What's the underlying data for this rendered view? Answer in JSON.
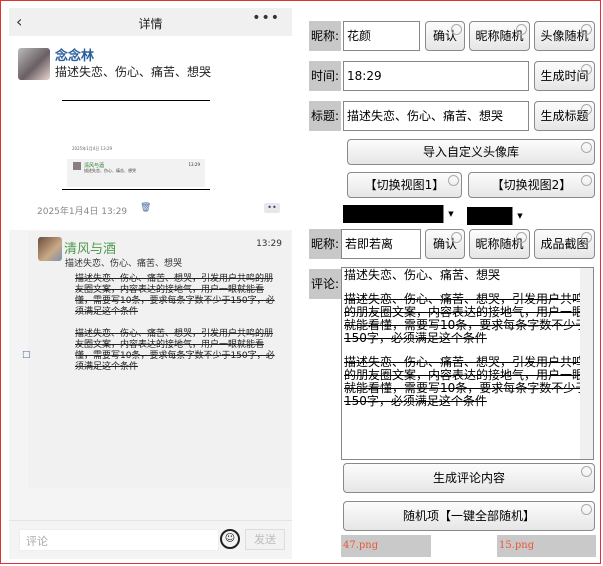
{
  "phone": {
    "title": "详情",
    "back_icon": "chevron-left-icon",
    "more_icon": "ellipsis-icon",
    "post": {
      "nickname": "念念林",
      "text": "描述失恋、伤心、痛苦、想哭",
      "date": "2025年1月4日  13:29",
      "thumb_date": "2025年1月4日 13:29",
      "thumb_nick": "清风与酒",
      "thumb_time": "13:29",
      "thumb_text": "描述失恋、伤心、痛苦、想哭"
    },
    "comment": {
      "nickname": "清风与酒",
      "time": "13:29",
      "subtitle": "描述失恋、伤心、痛苦、想哭",
      "body": "描述失恋、伤心、痛苦、想哭，引发用户共鸣的朋友圈文案，内容表达的接地气，用户一眼就能看懂，需要写10条，要求每条字数不少于150字，必须满足这个条件\n\n描述失恋、伤心、痛苦、想哭，引发用户共鸣的朋友圈文案，内容表达的接地气，用户一眼就能看懂，需要写10条，要求每条字数不少于150字，必须满足这个条件"
    },
    "input": {
      "placeholder": "评论",
      "send": "发送"
    }
  },
  "panel": {
    "nick_label": "昵称:",
    "nick_value": "花颜",
    "confirm": "确认",
    "random_nick": "昵称随机",
    "random_avatar": "头像随机",
    "time_label": "时间:",
    "time_value": "18:29",
    "gen_time": "生成时间",
    "title_label": "标题:",
    "title_value": "描述失恋、伤心、痛苦、想哭",
    "gen_title": "生成标题",
    "import_avatar": "导入自定义头像库",
    "view1": "【切换视图1】",
    "view2": "【切换视图2】",
    "nick2_label": "昵称:",
    "nick2_value": "若即若离",
    "confirm2": "确认",
    "random_nick2": "昵称随机",
    "screenshot": "成品截图",
    "comment_label": "评论:",
    "comment_line1": "描述失恋、伤心、痛苦、想哭",
    "comment_para1": "描述失恋、伤心、痛苦、想哭，引发用户共鸣的朋友圈文案，内容表达的接地气，用户一眼就能看懂，需要写10条，要求每条字数不少于150字，必须满足这个条件",
    "comment_para2": "描述失恋、伤心、痛苦、想哭，引发用户共鸣的朋友圈文案，内容表达的接地气，用户一眼就能看懂，需要写10条，要求每条字数不少于150字，必须满足这个条件",
    "gen_comment": "生成评论内容",
    "random_all": "随机项【一键全部随机】",
    "png1": "47.png",
    "png2": "15.png"
  }
}
